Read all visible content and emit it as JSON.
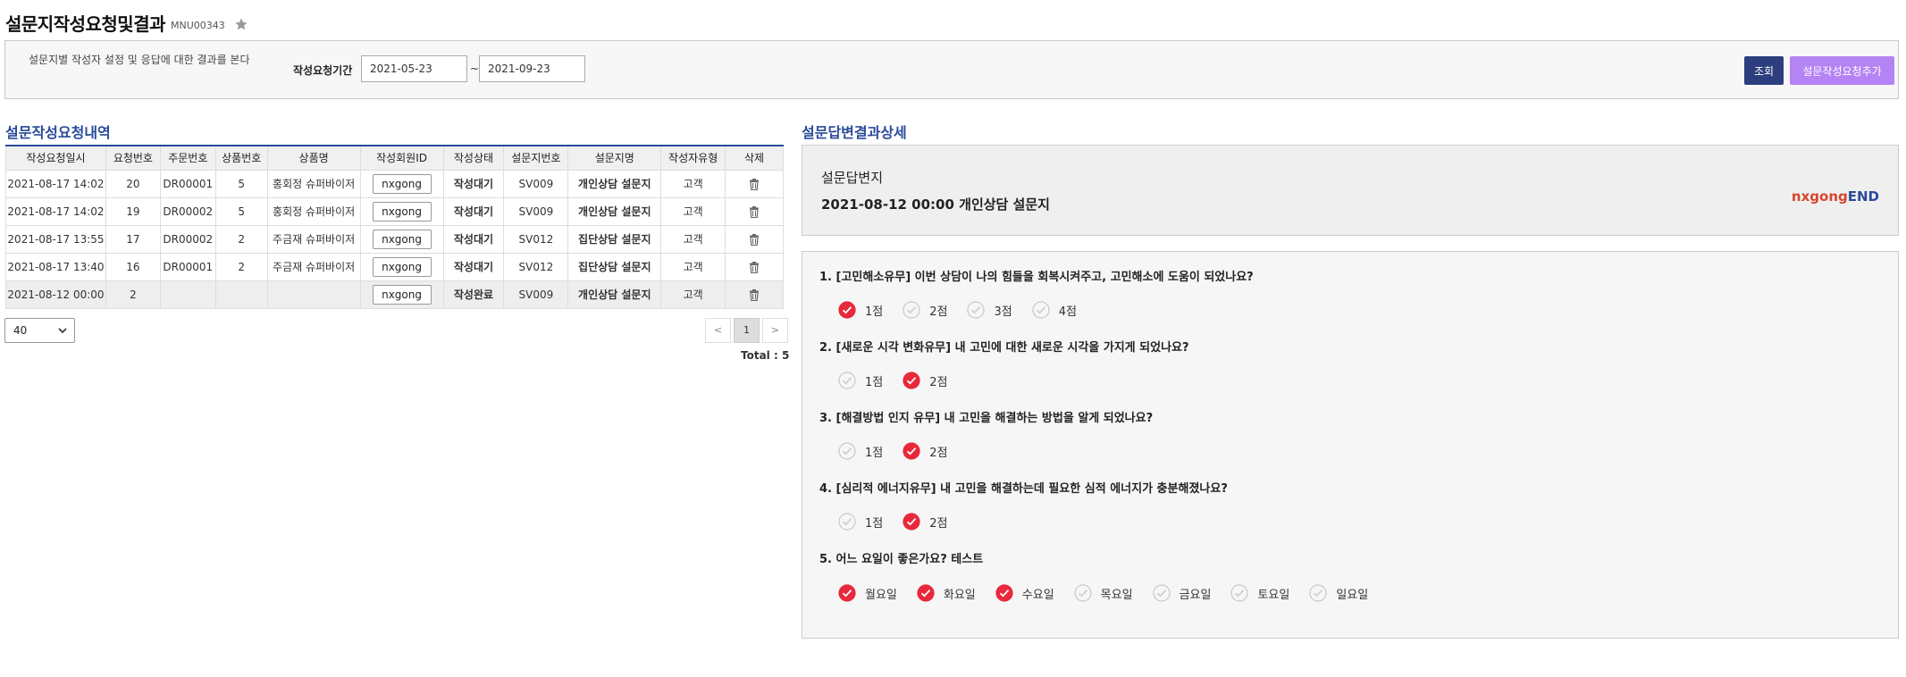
{
  "header": {
    "title": "설문지작성요청및결과",
    "menu_code": "MNU00343"
  },
  "filter": {
    "description": "설문지별 작성자 설정 및 응답에 대한 결과를 본다",
    "period_label": "작성요청기간",
    "date_from": "2021-05-23",
    "date_separator": "~",
    "date_to": "2021-09-23",
    "search_label": "조회",
    "add_label": "설문작성요청추가"
  },
  "left": {
    "title": "설문작성요청내역",
    "columns": [
      "작성요청일시",
      "요청번호",
      "주문번호",
      "상품번호",
      "상품명",
      "작성회원ID",
      "작성상태",
      "설문지번호",
      "설문지명",
      "작성자유형",
      "삭제"
    ],
    "rows": [
      {
        "date": "2021-08-17 14:02",
        "req_no": "20",
        "order_no": "DR00001",
        "product_no": "5",
        "product_name": "홍회정 슈퍼바이저",
        "member_id": "nxgong",
        "status": "작성대기",
        "survey_no": "SV009",
        "survey_name": "개인상담 설문지",
        "writer_type": "고객"
      },
      {
        "date": "2021-08-17 14:02",
        "req_no": "19",
        "order_no": "DR00002",
        "product_no": "5",
        "product_name": "홍회정 슈퍼바이저",
        "member_id": "nxgong",
        "status": "작성대기",
        "survey_no": "SV009",
        "survey_name": "개인상담 설문지",
        "writer_type": "고객"
      },
      {
        "date": "2021-08-17 13:55",
        "req_no": "17",
        "order_no": "DR00002",
        "product_no": "2",
        "product_name": "주금재 슈퍼바이저",
        "member_id": "nxgong",
        "status": "작성대기",
        "survey_no": "SV012",
        "survey_name": "집단상담 설문지",
        "writer_type": "고객"
      },
      {
        "date": "2021-08-17 13:40",
        "req_no": "16",
        "order_no": "DR00001",
        "product_no": "2",
        "product_name": "주금재 슈퍼바이저",
        "member_id": "nxgong",
        "status": "작성대기",
        "survey_no": "SV012",
        "survey_name": "집단상담 설문지",
        "writer_type": "고객"
      },
      {
        "date": "2021-08-12 00:00",
        "req_no": "2",
        "order_no": "",
        "product_no": "",
        "product_name": "",
        "member_id": "nxgong",
        "status": "작성완료",
        "survey_no": "SV009",
        "survey_name": "개인상담 설문지",
        "writer_type": "고객"
      }
    ],
    "page_size": "40",
    "pager": {
      "prev": "<",
      "current": "1",
      "next": ">"
    },
    "total": "Total : 5"
  },
  "right": {
    "title": "설문답변결과상세",
    "answer_label": "설문답변지",
    "answer_title": "2021-08-12 00:00 개인상담 설문지",
    "member": "nxgong",
    "member_suffix": "END",
    "questions": [
      {
        "title": "1. [고민해소유무] 이번 상담이 나의 힘들을 회복시켜주고, 고민해소에 도움이 되었나요?",
        "options": [
          {
            "label": "1점",
            "checked": true
          },
          {
            "label": "2점",
            "checked": false
          },
          {
            "label": "3점",
            "checked": false
          },
          {
            "label": "4점",
            "checked": false
          }
        ]
      },
      {
        "title": "2. [새로운 시각 변화유무] 내 고민에 대한 새로운 시각을 가지게 되었나요?",
        "options": [
          {
            "label": "1점",
            "checked": false
          },
          {
            "label": "2점",
            "checked": true
          }
        ]
      },
      {
        "title": "3. [해결방법 인지 유무] 내 고민을 해결하는 방법을 알게 되었나요?",
        "options": [
          {
            "label": "1점",
            "checked": false
          },
          {
            "label": "2점",
            "checked": true
          }
        ]
      },
      {
        "title": "4. [심리적 에너지유무] 내 고민을 해결하는데 필요한 심적 에너지가 충분해졌나요?",
        "options": [
          {
            "label": "1점",
            "checked": false
          },
          {
            "label": "2점",
            "checked": true
          }
        ]
      },
      {
        "title": "5. 어느 요일이 좋은가요? 테스트",
        "options": [
          {
            "label": "월요일",
            "checked": true
          },
          {
            "label": "화요일",
            "checked": true
          },
          {
            "label": "수요일",
            "checked": true
          },
          {
            "label": "목요일",
            "checked": false
          },
          {
            "label": "금요일",
            "checked": false
          },
          {
            "label": "토요일",
            "checked": false
          },
          {
            "label": "일요일",
            "checked": false
          }
        ]
      }
    ]
  },
  "colors": {
    "accent": "#2a4a9a",
    "search_button": "#2c3e7e",
    "add_button": "#b483f4",
    "check_on": "#e8283c",
    "member_name": "#d8442c"
  }
}
